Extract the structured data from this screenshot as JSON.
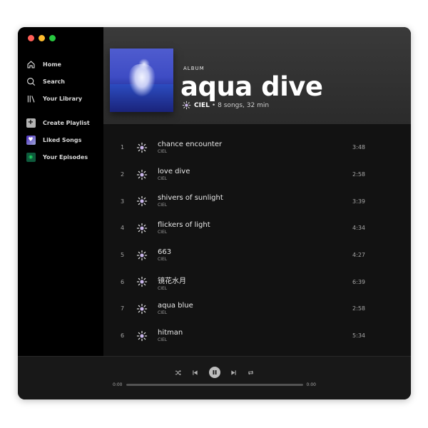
{
  "sidebar": {
    "nav": [
      {
        "label": "Home",
        "icon": "home-icon"
      },
      {
        "label": "Search",
        "icon": "search-icon"
      },
      {
        "label": "Your Library",
        "icon": "library-icon"
      }
    ],
    "library": [
      {
        "label": "Create Playlist",
        "icon": "plus-icon"
      },
      {
        "label": "Liked Songs",
        "icon": "heart-icon"
      },
      {
        "label": "Your Episodes",
        "icon": "podcast-icon"
      }
    ]
  },
  "album": {
    "kind": "ALBUM",
    "title": "aqua dive",
    "artist": "CIEL",
    "separator": "•",
    "summary": "8 songs, 32 min"
  },
  "tracks": [
    {
      "num": "1",
      "title": "chance encounter",
      "artist": "CIEL",
      "duration": "3:48"
    },
    {
      "num": "2",
      "title": "love dive",
      "artist": "CIEL",
      "duration": "2:58"
    },
    {
      "num": "3",
      "title": "shivers of sunlight",
      "artist": "CIEL",
      "duration": "3:39"
    },
    {
      "num": "4",
      "title": "flickers of light",
      "artist": "CIEL",
      "duration": "4:34"
    },
    {
      "num": "5",
      "title": "663",
      "artist": "CIEL",
      "duration": "4:27"
    },
    {
      "num": "6",
      "title": "镜花水月",
      "artist": "CIEL",
      "duration": "6:39"
    },
    {
      "num": "7",
      "title": "aqua blue",
      "artist": "CIEL",
      "duration": "2:58"
    },
    {
      "num": "6",
      "title": "hitman",
      "artist": "CIEL",
      "duration": "5:34"
    }
  ],
  "player": {
    "elapsed": "0:00",
    "total": "0:00",
    "progress_fraction": 0
  },
  "colors": {
    "background": "#121212",
    "sidebar": "#000000",
    "accent_green": "#1ed760"
  }
}
